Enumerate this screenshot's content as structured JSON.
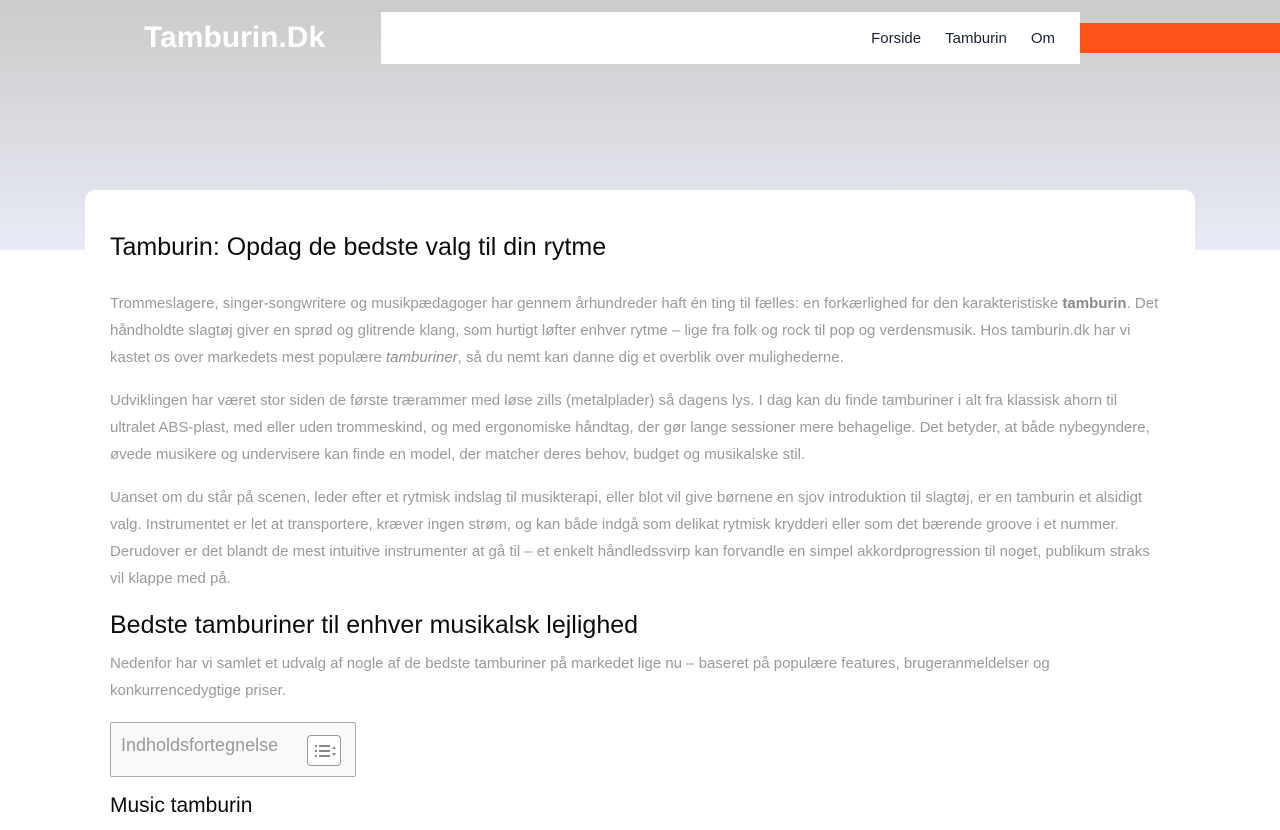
{
  "site": {
    "title": "Tamburin.Dk"
  },
  "nav": {
    "items": [
      "Forside",
      "Tamburin",
      "Om"
    ]
  },
  "colors": {
    "accent": "#ff5219",
    "heading": "#0b0b0b",
    "body_text": "#9a9a9a",
    "nav_text": "#1a2333"
  },
  "article": {
    "title": "Tamburin: Opdag de bedste valg til din rytme",
    "p1": {
      "a": "Trommeslagere, singer-songwritere og musikpædagoger har gennem århundreder haft én ting til fælles: en forkærlighed for den karakteristiske ",
      "b": "tamburin",
      "c": ". Det håndholdte slagtøj giver en sprød og glitrende klang, som hurtigt løfter enhver rytme – lige fra folk og rock til pop og verdensmusik. Hos tamburin.dk har vi kastet os over markedets mest populære ",
      "d": "tamburiner",
      "e": ", så du nemt kan danne dig et overblik over mulighederne."
    },
    "p2": "Udviklingen har været stor siden de første trærammer med løse zills (metalplader) så dagens lys. I dag kan du finde tamburiner i alt fra klassisk ahorn til ultralet ABS-plast, med eller uden trommeskind, og med ergonomiske håndtag, der gør lange sessioner mere behagelige. Det betyder, at både nybegyndere, øvede musikere og undervisere kan finde en model, der matcher deres behov, budget og musikalske stil.",
    "p3": "Uanset om du står på scenen, leder efter et rytmisk indslag til musikterapi, eller blot vil give børnene en sjov introduktion til slagtøj, er en tamburin et alsidigt valg. Instrumentet er let at transportere, kræver ingen strøm, og kan både indgå som delikat rytmisk krydderi eller som det bærende groove i et nummer. Derudover er det blandt de mest intuitive instrumenter at gå til – et enkelt håndledssvirp kan forvandle en simpel akkordprogression til noget, publikum straks vil klappe med på.",
    "section_title": "Bedste tamburiner til enhver musikalsk lejlighed",
    "section_intro": "Nedenfor har vi samlet et udvalg af nogle af de bedste tamburiner på markedet lige nu – baseret på populære features, brugeranmeldelser og konkurrencedygtige priser.",
    "toc_title": "Indholdsfortegnelse",
    "toc_toggle_icon": "list-toggle-icon",
    "next_heading": "Music tamburin"
  }
}
